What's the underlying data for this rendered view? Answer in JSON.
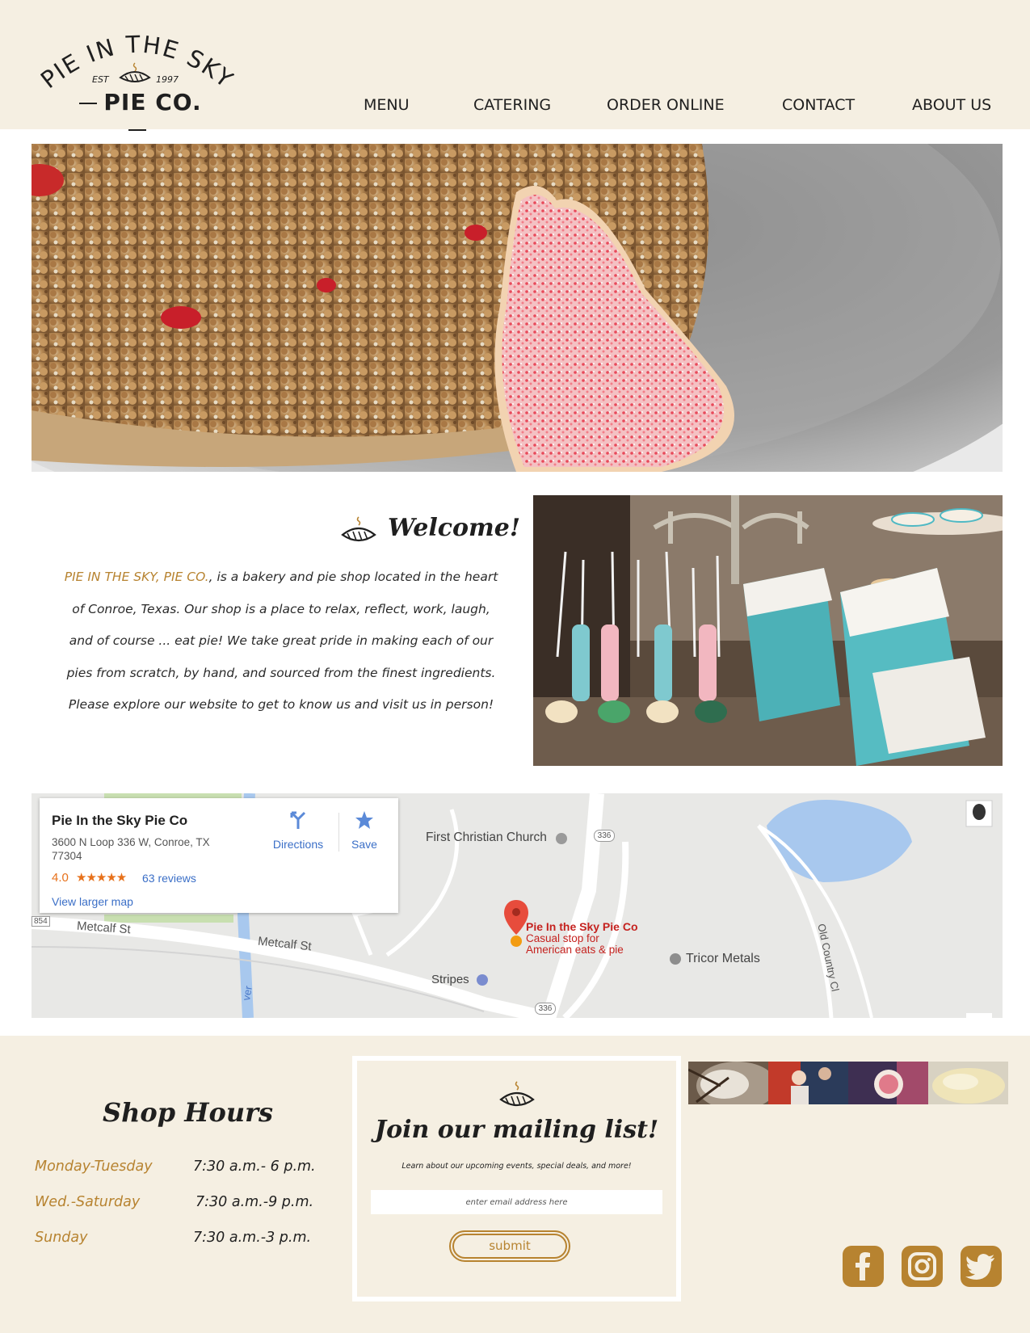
{
  "header": {
    "logo": {
      "arc_text": "PIE IN THE SKY",
      "est_left": "EST",
      "est_right": "1997",
      "main_text": "PIE CO."
    },
    "nav": [
      "MENU",
      "CATERING",
      "ORDER ONLINE",
      "CONTACT",
      "ABOUT US"
    ]
  },
  "welcome": {
    "title": "Welcome!",
    "brand": "PIE IN THE SKY, PIE CO.",
    "body": ", is a bakery and pie shop located in the heart of Conroe, Texas. Our shop is a place to relax, reflect, work, laugh, and of course ... eat pie! We take great pride in making each of our pies from scratch, by hand, and sourced from the finest ingredients. Please explore our website to get to know us and visit us in person!"
  },
  "map": {
    "place_name": "Pie In the Sky Pie Co",
    "address": "3600 N Loop 336 W, Conroe, TX 77304",
    "rating": "4.0",
    "stars": "★★★★★",
    "reviews": "63 reviews",
    "directions": "Directions",
    "save": "Save",
    "larger_map": "View larger map",
    "pin_title": "Pie In the Sky Pie Co",
    "pin_line1": "Casual stop for",
    "pin_line2": "American eats & pie",
    "labels": {
      "church": "First Christian Church",
      "metcalf1": "Metcalf St",
      "metcalf2": "Metcalf St",
      "stripes": "Stripes",
      "tricor": "Tricor Metals",
      "old_country": "Old Country Cl",
      "road_854": "854",
      "route_336a": "336",
      "route_336b": "336",
      "river": "ver"
    }
  },
  "hours": {
    "title": "Shop Hours",
    "rows": [
      {
        "day": "Monday-Tuesday",
        "time": "7:30 a.m.- 6 p.m."
      },
      {
        "day": "Wed.-Saturday",
        "time": "7:30 a.m.-9 p.m."
      },
      {
        "day": "Sunday",
        "time": "7:30 a.m.-3 p.m."
      }
    ]
  },
  "mailing": {
    "title": "Join our mailing list!",
    "subtitle": "Learn about our upcoming events, special deals, and more!",
    "placeholder": "enter email address here",
    "submit": "submit"
  },
  "social": [
    "facebook-icon",
    "instagram-icon",
    "twitter-icon"
  ],
  "colors": {
    "cream": "#f5efe2",
    "gold": "#b78330",
    "text": "#1f1f1f",
    "map_link": "#3b6fc7",
    "pin": "#c5221f"
  }
}
